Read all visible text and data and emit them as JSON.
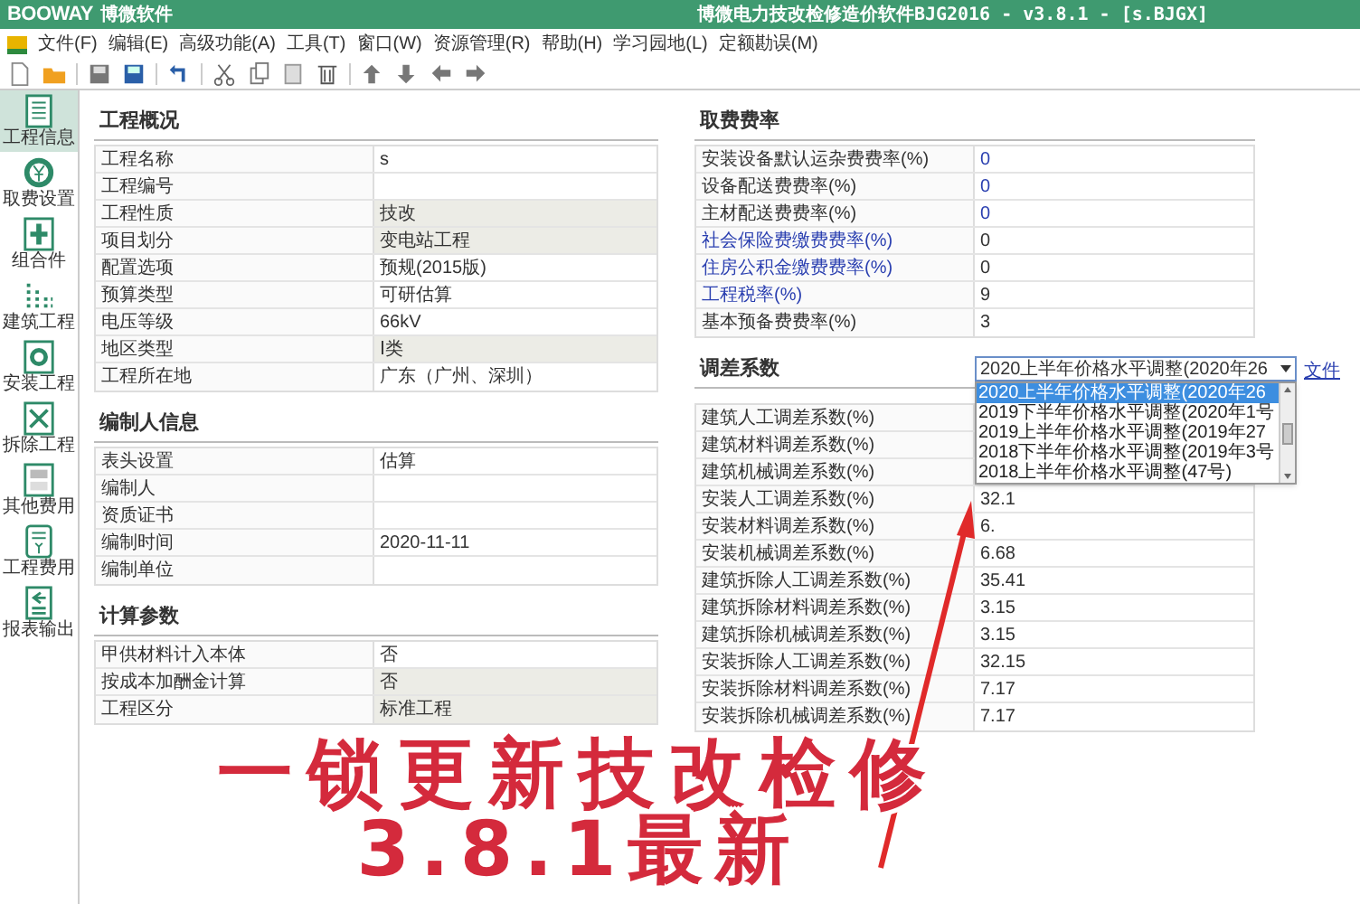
{
  "window": {
    "logo": "BOOWAY",
    "logo_sub": "博微软件",
    "title": "博微电力技改检修造价软件BJG2016 - v3.8.1 - [s.BJGX]"
  },
  "menu": [
    {
      "label": "文件(F)"
    },
    {
      "label": "编辑(E)"
    },
    {
      "label": "高级功能(A)"
    },
    {
      "label": "工具(T)"
    },
    {
      "label": "窗口(W)"
    },
    {
      "label": "资源管理(R)"
    },
    {
      "label": "帮助(H)"
    },
    {
      "label": "学习园地(L)"
    },
    {
      "label": "定额勘误(M)"
    }
  ],
  "sidebar": [
    {
      "label": "工程信息",
      "selected": true
    },
    {
      "label": "取费设置",
      "selected": false
    },
    {
      "label": "组合件",
      "selected": false
    },
    {
      "label": "建筑工程",
      "selected": false
    },
    {
      "label": "安装工程",
      "selected": false
    },
    {
      "label": "拆除工程",
      "selected": false
    },
    {
      "label": "其他费用",
      "selected": false
    },
    {
      "label": "工程费用",
      "selected": false
    },
    {
      "label": "报表输出",
      "selected": false
    }
  ],
  "left_sections": [
    {
      "title": "工程概况",
      "rows": [
        {
          "label": "工程名称",
          "value": "s",
          "readonly": false
        },
        {
          "label": "工程编号",
          "readonly": false
        },
        {
          "label": "工程性质",
          "value": "技改",
          "readonly": true
        },
        {
          "label": "项目划分",
          "value": "变电站工程",
          "readonly": true
        },
        {
          "label": "配置选项",
          "value": "预规(2015版)",
          "readonly": false
        },
        {
          "label": "预算类型",
          "value": "可研估算",
          "readonly": false
        },
        {
          "label": "电压等级",
          "value": "66kV",
          "readonly": false
        },
        {
          "label": "地区类型",
          "value": "Ⅰ类",
          "readonly": true
        },
        {
          "label": "工程所在地",
          "value": "广东（广州、深圳）",
          "readonly": false
        }
      ]
    },
    {
      "title": "编制人信息",
      "rows": [
        {
          "label": "表头设置",
          "value": "估算",
          "readonly": false
        },
        {
          "label": "编制人",
          "readonly": false
        },
        {
          "label": "资质证书",
          "readonly": false
        },
        {
          "label": "编制时间",
          "value": "2020-11-11",
          "readonly": false
        },
        {
          "label": "编制单位",
          "readonly": false
        }
      ]
    },
    {
      "title": "计算参数",
      "rows": [
        {
          "label": "甲供材料计入本体",
          "value": "否",
          "readonly": false
        },
        {
          "label": "按成本加酬金计算",
          "value": "否",
          "readonly": true
        },
        {
          "label": "工程区分",
          "value": "标准工程",
          "readonly": true
        }
      ]
    }
  ],
  "fee_rates": {
    "title": "取费费率",
    "rows": [
      {
        "label": "安装设备默认运杂费费率(%)",
        "value": "0",
        "label_link": false,
        "value_link": true
      },
      {
        "label": "设备配送费费率(%)",
        "value": "0",
        "label_link": false,
        "value_link": true
      },
      {
        "label": "主材配送费费率(%)",
        "value": "0",
        "label_link": false,
        "value_link": true
      },
      {
        "label": "社会保险费缴费费率(%)",
        "value": "0",
        "label_link": true,
        "value_link": false
      },
      {
        "label": "住房公积金缴费费率(%)",
        "value": "0",
        "label_link": true,
        "value_link": false
      },
      {
        "label": "工程税率(%)",
        "value": "9",
        "label_link": true,
        "value_link": false
      },
      {
        "label": "基本预备费费率(%)",
        "value": "3",
        "label_link": false,
        "value_link": false
      }
    ]
  },
  "adjustment": {
    "title": "调差系数",
    "combo": {
      "value": "2020上半年价格水平调整(2020年26"
    },
    "link": "文件",
    "options": [
      {
        "label": "2020上半年价格水平调整(2020年26",
        "selected": true
      },
      {
        "label": "2019下半年价格水平调整(2020年1号",
        "selected": false
      },
      {
        "label": "2019上半年价格水平调整(2019年27",
        "selected": false
      },
      {
        "label": "2018下半年价格水平调整(2019年3号",
        "selected": false
      },
      {
        "label": "2018上半年价格水平调整(47号)",
        "selected": false
      }
    ],
    "rows": [
      {
        "label": "建筑人工调差系数(%)"
      },
      {
        "label": "建筑材料调差系数(%)"
      },
      {
        "label": "建筑机械调差系数(%)"
      },
      {
        "label": "安装人工调差系数(%)",
        "value": "32.1"
      },
      {
        "label": "安装材料调差系数(%)",
        "value": "6."
      },
      {
        "label": "安装机械调差系数(%)",
        "value": "6.68"
      },
      {
        "label": "建筑拆除人工调差系数(%)",
        "value": "35.41"
      },
      {
        "label": "建筑拆除材料调差系数(%)",
        "value": "3.15"
      },
      {
        "label": "建筑拆除机械调差系数(%)",
        "value": "3.15"
      },
      {
        "label": "安装拆除人工调差系数(%)",
        "value": "32.15"
      },
      {
        "label": "安装拆除材料调差系数(%)",
        "value": "7.17"
      },
      {
        "label": "安装拆除机械调差系数(%)",
        "value": "7.17"
      }
    ]
  },
  "caption": {
    "lines": [
      "一锁更新技改检修",
      "3.8.1最新"
    ]
  }
}
